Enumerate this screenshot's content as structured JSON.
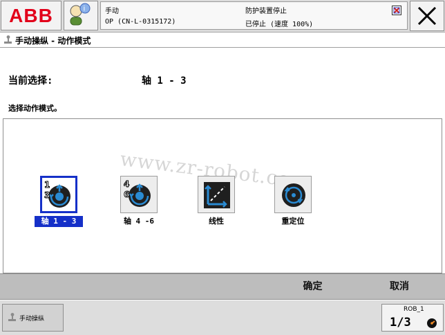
{
  "app": {
    "brand": "ABB"
  },
  "status": {
    "mode": "手动",
    "controller": "OP (CN-L-0315172)",
    "safety": "防护装置停止",
    "state": "已停止 (速度 100%)"
  },
  "header": {
    "title": "手动操纵 - 动作模式"
  },
  "selection": {
    "current_label": "当前选择:",
    "current_value": "轴 1 - 3",
    "instruction": "选择动作模式。"
  },
  "modes": [
    {
      "label": "轴 1 - 3",
      "selected": true
    },
    {
      "label": "轴 4 -6",
      "selected": false
    },
    {
      "label": "线性",
      "selected": false
    },
    {
      "label": "重定位",
      "selected": false
    }
  ],
  "actions": {
    "ok": "确定",
    "cancel": "取消"
  },
  "taskbar": {
    "jogging": "手动操纵",
    "robot": "ROB_1",
    "fraction": "1/3"
  },
  "watermark": "www.zr-robot.com",
  "icons": {
    "info": "info-person-icon",
    "close": "close-icon",
    "jog": "joystick-icon",
    "status": "warning-icon",
    "axis13": "axis-1-3-icon",
    "axis46": "axis-4-6-icon",
    "linear": "linear-icon",
    "reorient": "reorient-icon"
  },
  "colors": {
    "selected": "#1530c8",
    "abb_red": "#e2001a"
  }
}
